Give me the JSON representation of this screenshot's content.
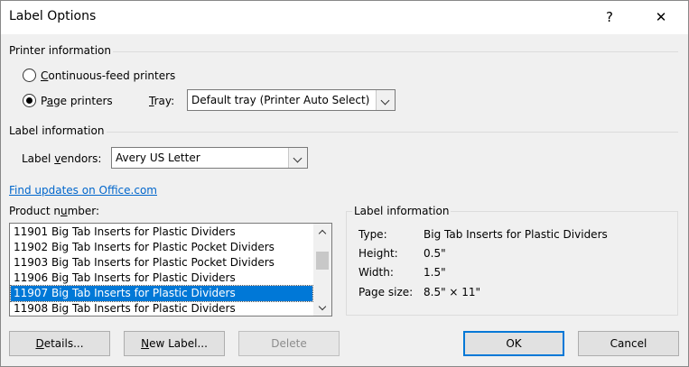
{
  "window": {
    "title": "Label Options",
    "help": "?",
    "close": "✕"
  },
  "printer": {
    "heading": "Printer information",
    "continuous": {
      "accel": "C",
      "rest": "ontinuous-feed printers",
      "selected": false
    },
    "page": {
      "pre": "P",
      "accel": "a",
      "rest": "ge printers",
      "selected": true
    },
    "tray_label_accel": "T",
    "tray_label_rest": "ray:",
    "tray_value": "Default tray (Printer Auto Select)"
  },
  "label_info": {
    "heading": "Label information",
    "vendor_label_pre": "Label ",
    "vendor_label_accel": "v",
    "vendor_label_rest": "endors:",
    "vendor_value": "Avery US Letter",
    "find_updates": "Find updates on Office.com"
  },
  "product": {
    "label_pre": "Product n",
    "label_accel": "u",
    "label_rest": "mber:",
    "items": [
      "11901 Big Tab Inserts for Plastic Dividers",
      "11902 Big Tab Inserts for Plastic Pocket Dividers",
      "11903 Big Tab Inserts for Plastic Pocket Dividers",
      "11906 Big Tab Inserts for Plastic Dividers",
      "11907 Big Tab Inserts for Plastic Dividers",
      "11908 Big Tab Inserts for Plastic Dividers"
    ],
    "selected_index": 4
  },
  "details": {
    "heading": "Label information",
    "type_label": "Type:",
    "type_value": "Big Tab Inserts for Plastic Dividers",
    "height_label": "Height:",
    "height_value": "0.5\"",
    "width_label": "Width:",
    "width_value": "1.5\"",
    "pagesize_label": "Page size:",
    "pagesize_value": "8.5\" × 11\""
  },
  "buttons": {
    "details_accel": "D",
    "details_rest": "etails...",
    "new_label_accel": "N",
    "new_label_rest": "ew Label...",
    "delete": "Delete",
    "ok": "OK",
    "cancel": "Cancel"
  },
  "colors": {
    "accent": "#0078d7",
    "link": "#0066cc",
    "background": "#f0f0f0"
  }
}
